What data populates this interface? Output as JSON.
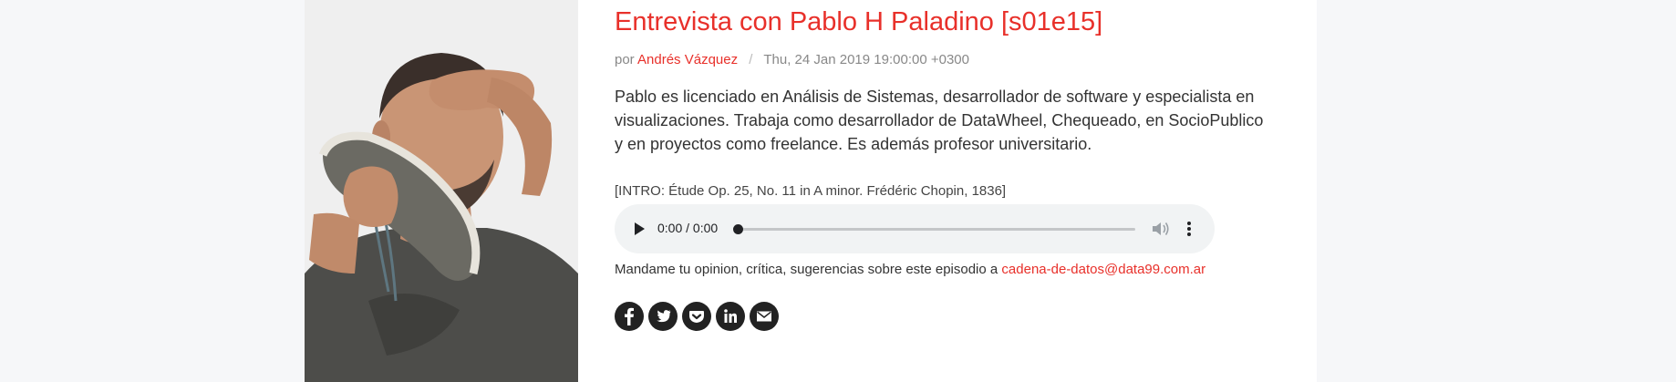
{
  "episode": {
    "title": "Entrevista con Pablo H Paladino [s01e15]",
    "meta": {
      "by_label": "por",
      "author": "Andrés Vázquez",
      "separator": "/",
      "date": "Thu, 24 Jan 2019 19:00:00 +0300"
    },
    "description": "Pablo es licenciado en Análisis de Sistemas, desarrollador de software y especialista en visualizaciones. Trabaja como desarrollador de DataWheel, Chequeado, en SocioPublico y en proyectos como freelance. Es además profesor universitario.",
    "intro": "[INTRO: Étude Op. 25, No. 11 in A minor. Frédéric Chopin, 1836]",
    "player": {
      "time": "0:00 / 0:00",
      "progress": 0
    },
    "feedback": {
      "text": "Mandame tu opinion, crítica, sugerencias sobre este episodio a ",
      "email": "cadena-de-datos@data99.com.ar"
    },
    "share": [
      "facebook-icon",
      "twitter-icon",
      "pocket-icon",
      "linkedin-icon",
      "email-icon"
    ]
  },
  "colors": {
    "accent": "#e8302a",
    "text": "#333333",
    "muted": "#888888",
    "player_bg": "#f1f3f4",
    "page_bg": "#f6f7f9"
  }
}
